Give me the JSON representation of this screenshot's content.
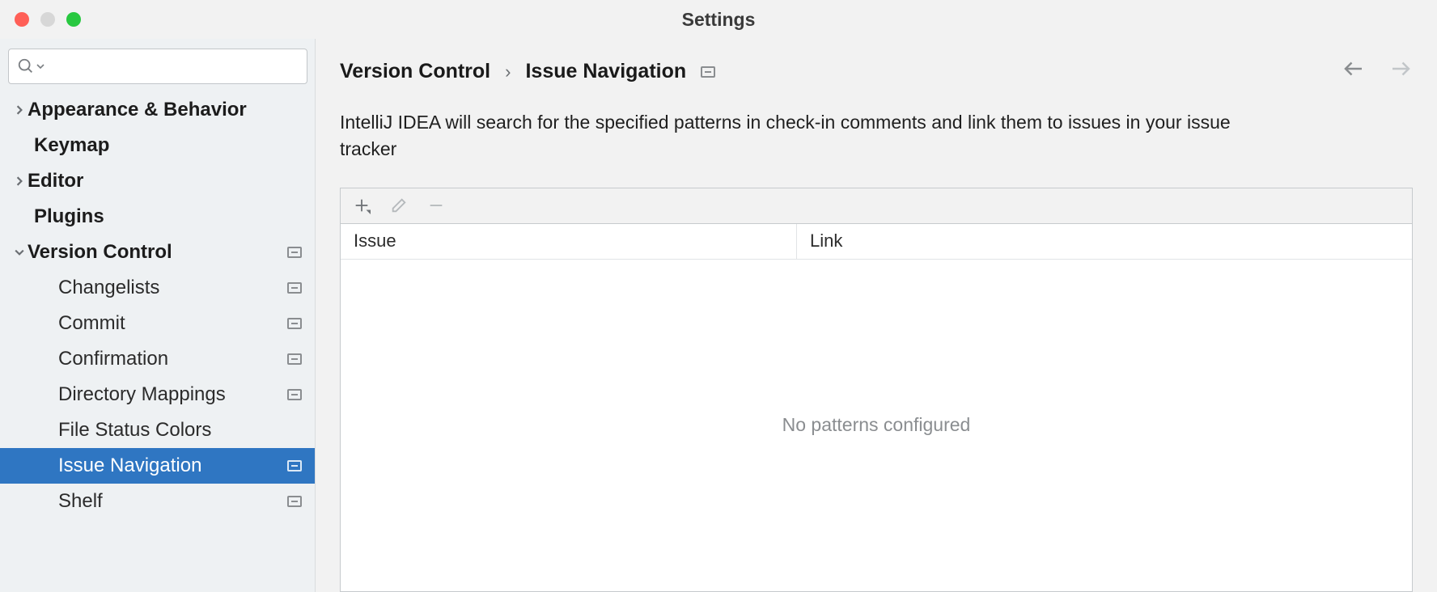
{
  "title": "Settings",
  "sidebar": {
    "items": [
      {
        "label": "Appearance & Behavior",
        "expandable": true,
        "expanded": false
      },
      {
        "label": "Keymap"
      },
      {
        "label": "Editor",
        "expandable": true,
        "expanded": false
      },
      {
        "label": "Plugins"
      },
      {
        "label": "Version Control",
        "expandable": true,
        "expanded": true,
        "project": true,
        "children": [
          {
            "label": "Changelists",
            "project": true
          },
          {
            "label": "Commit",
            "project": true
          },
          {
            "label": "Confirmation",
            "project": true
          },
          {
            "label": "Directory Mappings",
            "project": true
          },
          {
            "label": "File Status Colors"
          },
          {
            "label": "Issue Navigation",
            "project": true,
            "selected": true
          },
          {
            "label": "Shelf",
            "project": true
          }
        ]
      }
    ]
  },
  "breadcrumb": {
    "root": "Version Control",
    "current": "Issue Navigation"
  },
  "description": "IntelliJ IDEA will search for the specified patterns in check-in comments and link them to issues in your issue tracker",
  "table": {
    "columns": {
      "issue": "Issue",
      "link": "Link"
    },
    "empty": "No patterns configured"
  }
}
